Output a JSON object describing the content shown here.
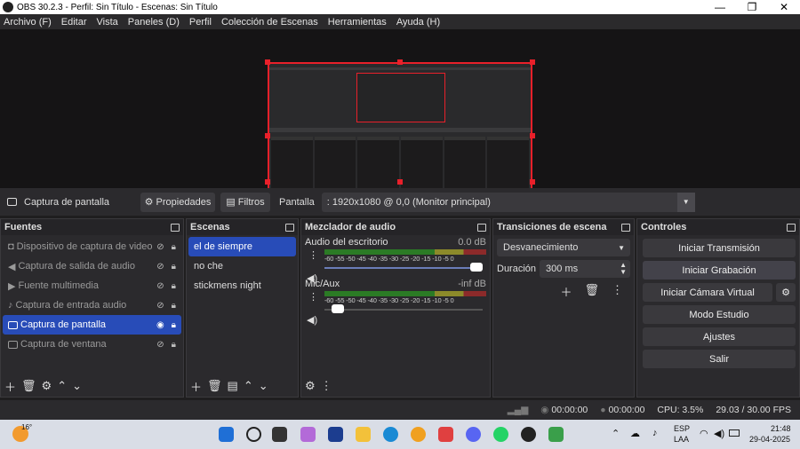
{
  "window": {
    "title": "OBS 30.2.3 - Perfil: Sin Título - Escenas: Sin Título",
    "minimize": "—",
    "maximize": "❐",
    "close": "✕"
  },
  "menu": [
    "Archivo (F)",
    "Editar",
    "Vista",
    "Paneles (D)",
    "Perfil",
    "Colección de Escenas",
    "Herramientas",
    "Ayuda (H)"
  ],
  "source_toolbar": {
    "current_source": "Captura de pantalla",
    "properties": "Propiedades",
    "filters": "Filtros",
    "display_label": "Pantalla",
    "display_value": ": 1920x1080 @ 0,0 (Monitor principal)"
  },
  "sources": {
    "title": "Fuentes",
    "items": [
      {
        "label": "Dispositivo de captura de video",
        "icon": "camera-icon"
      },
      {
        "label": "Captura de salida de audio",
        "icon": "speaker-icon"
      },
      {
        "label": "Fuente multimedia",
        "icon": "play-icon"
      },
      {
        "label": "Captura de entrada audio",
        "icon": "microphone-icon"
      },
      {
        "label": "Captura de pantalla",
        "icon": "monitor-icon",
        "selected": true
      },
      {
        "label": "Captura de ventana",
        "icon": "window-icon"
      }
    ]
  },
  "scenes": {
    "title": "Escenas",
    "items": [
      "el de siempre",
      "no che",
      "stickmens night"
    ],
    "selected": 0
  },
  "mixer": {
    "title": "Mezclador de audio",
    "scale": "-60 -55 -50 -45 -40 -35 -30 -25 -20 -15 -10 -5  0",
    "channels": [
      {
        "name": "Audio del escritorio",
        "db": "0.0 dB",
        "volume": 1.0
      },
      {
        "name": "Mic/Aux",
        "db": "-inf dB",
        "volume": 0.05
      }
    ]
  },
  "transitions": {
    "title": "Transiciones de escena",
    "type": "Desvanecimiento",
    "duration_label": "Duración",
    "duration_value": "300 ms"
  },
  "controls": {
    "title": "Controles",
    "buttons": [
      "Iniciar Transmisión",
      "Iniciar Grabación",
      "Iniciar Cámara Virtual",
      "Modo Estudio",
      "Ajustes",
      "Salir"
    ]
  },
  "status": {
    "stream_time": "00:00:00",
    "rec_time": "00:00:00",
    "cpu": "CPU: 3.5%",
    "fps": "29.03 / 30.00 FPS"
  },
  "taskbar": {
    "weather": "16°",
    "lang1": "ESP",
    "lang2": "LAA",
    "time": "21:48",
    "date": "29-04-2025"
  },
  "colors": {
    "accent": "#284cb8",
    "selection_border": "#e8202a"
  }
}
